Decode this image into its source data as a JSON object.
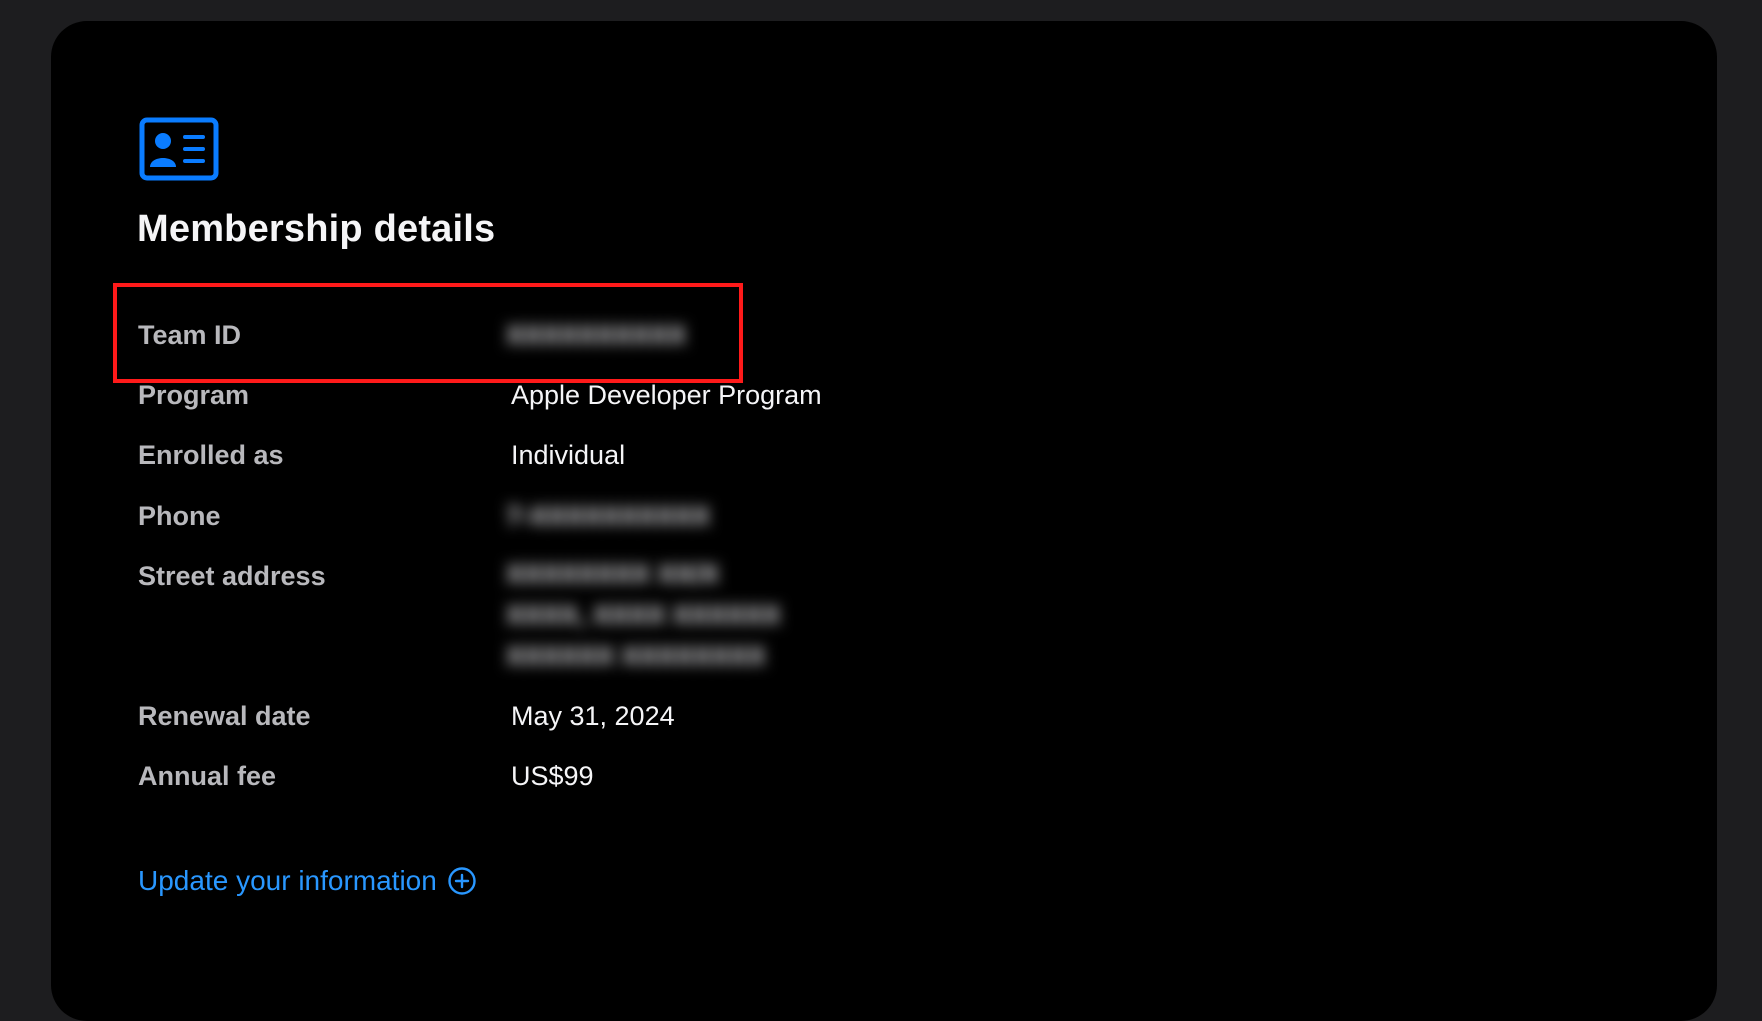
{
  "card": {
    "icon": "contact-card-icon",
    "title": "Membership details"
  },
  "details": {
    "team_id": {
      "label": "Team ID",
      "value": "XXXXXXXXXX",
      "blurred": true
    },
    "program": {
      "label": "Program",
      "value": "Apple Developer Program"
    },
    "enrolled_as": {
      "label": "Enrolled as",
      "value": "Individual"
    },
    "phone": {
      "label": "Phone",
      "value": "7-XXXXXXXXXX",
      "blurred": true
    },
    "street_address": {
      "label": "Street address",
      "lines": [
        "XXXXXXXX XX/X",
        "XXXX, XXXX XXXXXX",
        "XXXXXX XXXXXXXX"
      ],
      "blurred": true
    },
    "renewal_date": {
      "label": "Renewal date",
      "value": "May 31, 2024"
    },
    "annual_fee": {
      "label": "Annual fee",
      "value": "US$99"
    }
  },
  "actions": {
    "update_label": "Update your information",
    "update_icon": "plus-circle-icon"
  },
  "colors": {
    "page_background": "#1d1d1f",
    "card_background": "#000000",
    "accent": "#2997ff",
    "highlight": "#ff1a1a"
  }
}
